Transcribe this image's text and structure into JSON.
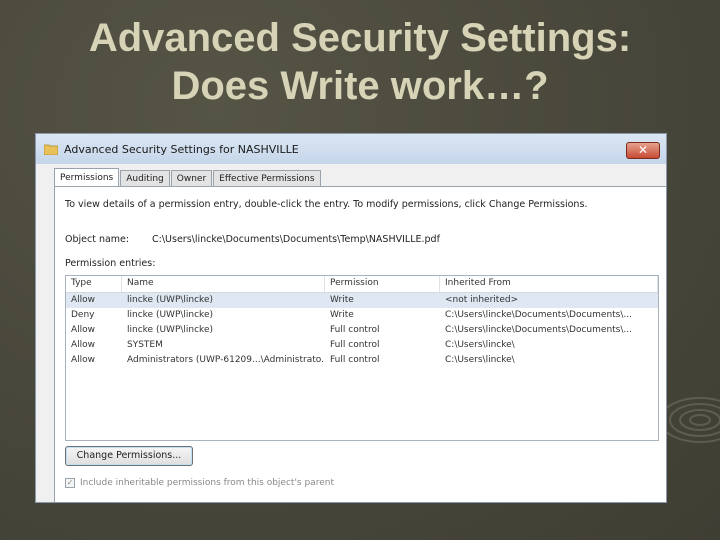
{
  "slide": {
    "title_line1": "Advanced Security Settings:",
    "title_line2": "Does Write work…?"
  },
  "window": {
    "title": "Advanced Security Settings for NASHVILLE",
    "close_label": "✕"
  },
  "tabs": [
    {
      "label": "Permissions",
      "active": true
    },
    {
      "label": "Auditing",
      "active": false
    },
    {
      "label": "Owner",
      "active": false
    },
    {
      "label": "Effective Permissions",
      "active": false
    }
  ],
  "panel": {
    "info_text": "To view details of a permission entry, double-click the entry. To modify permissions, click Change Permissions.",
    "object_name_label": "Object name:",
    "object_name_value": "C:\\Users\\lincke\\Documents\\Documents\\Temp\\NASHVILLE.pdf",
    "entries_label": "Permission entries:"
  },
  "table": {
    "columns": [
      "Type",
      "Name",
      "Permission",
      "Inherited From"
    ],
    "rows": [
      [
        "Allow",
        "lincke (UWP\\lincke)",
        "Write",
        "<not inherited>"
      ],
      [
        "Deny",
        "lincke (UWP\\lincke)",
        "Write",
        "C:\\Users\\lincke\\Documents\\Documents\\..."
      ],
      [
        "Allow",
        "lincke (UWP\\lincke)",
        "Full control",
        "C:\\Users\\lincke\\Documents\\Documents\\..."
      ],
      [
        "Allow",
        "SYSTEM",
        "Full control",
        "C:\\Users\\lincke\\"
      ],
      [
        "Allow",
        "Administrators (UWP-61209...\\Administrato...",
        "Full control",
        "C:\\Users\\lincke\\"
      ]
    ]
  },
  "buttons": {
    "change_permissions": "Change Permissions..."
  },
  "inherit_checkbox": {
    "label": "Include inheritable permissions from this object's parent",
    "check_mark": "✓"
  }
}
